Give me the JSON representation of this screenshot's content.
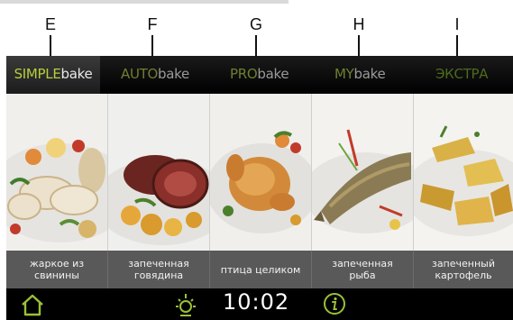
{
  "callouts": [
    "E",
    "F",
    "G",
    "H",
    "I"
  ],
  "tabs": [
    {
      "part1": "SIMPLE",
      "part2": "bake",
      "active": true
    },
    {
      "part1": "AUTO",
      "part2": "bake",
      "active": false
    },
    {
      "part1": "PRO",
      "part2": "bake",
      "active": false
    },
    {
      "part1": "MY",
      "part2": "bake",
      "active": false
    },
    {
      "part1": "ЭКСТРА",
      "part2": "",
      "active": false
    }
  ],
  "dishes": [
    {
      "line1": "жаркое из",
      "line2": "свинины"
    },
    {
      "line1": "запеченная",
      "line2": "говядина"
    },
    {
      "line1": "птица целиком",
      "line2": ""
    },
    {
      "line1": "запеченная",
      "line2": "рыба"
    },
    {
      "line1": "запеченный",
      "line2": "картофель"
    }
  ],
  "status": {
    "time": "10:02",
    "icons": [
      "home-icon",
      "light-icon",
      "info-icon"
    ]
  },
  "colors": {
    "accent": "#9bc038",
    "tab_active_text": "#b6cf3c",
    "label_bar": "#595959"
  }
}
